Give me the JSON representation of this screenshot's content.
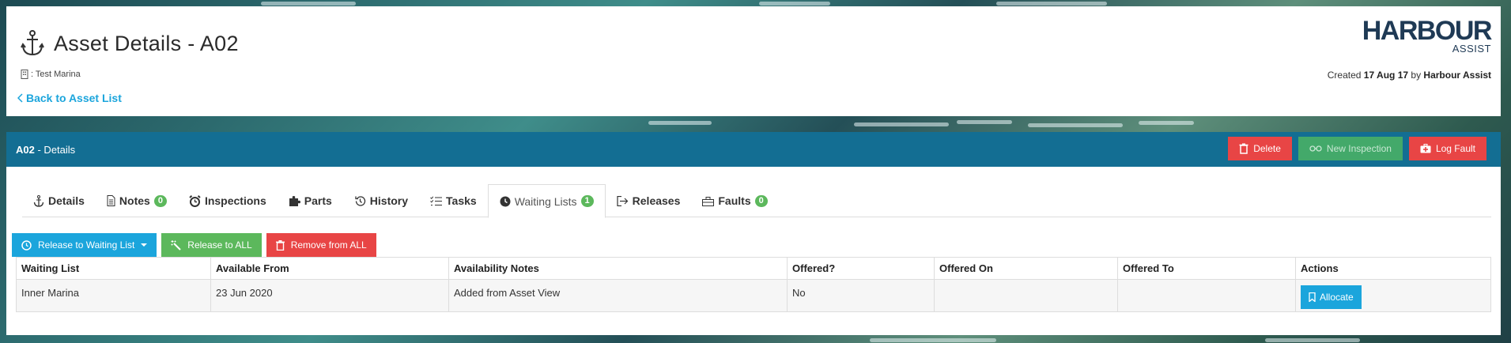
{
  "header": {
    "title": "Asset Details - A02",
    "marina": ": Test Marina",
    "back_link": "Back to Asset List",
    "logo_main": "HARBOUR",
    "logo_sub": "ASSIST",
    "created_prefix": "Created",
    "created_date": "17 Aug 17",
    "created_by_prefix": "by",
    "created_by": "Harbour Assist"
  },
  "details_bar": {
    "asset": "A02",
    "suffix": "- Details",
    "buttons": {
      "delete": "Delete",
      "new_inspection": "New Inspection",
      "log_fault": "Log Fault"
    }
  },
  "tabs": [
    {
      "label": "Details",
      "icon": "anchor-icon"
    },
    {
      "label": "Notes",
      "badge": "0",
      "icon": "file-icon"
    },
    {
      "label": "Inspections",
      "icon": "alarm-icon"
    },
    {
      "label": "Parts",
      "icon": "puzzle-icon"
    },
    {
      "label": "History",
      "icon": "history-icon"
    },
    {
      "label": "Tasks",
      "icon": "checklist-icon"
    },
    {
      "label": "Waiting Lists",
      "badge": "1",
      "icon": "clock-icon",
      "active": true
    },
    {
      "label": "Releases",
      "icon": "exit-icon"
    },
    {
      "label": "Faults",
      "badge": "0",
      "icon": "toolbox-icon"
    }
  ],
  "toolbar": {
    "release_waiting": "Release to Waiting List",
    "release_all": "Release to ALL",
    "remove_all": "Remove from ALL"
  },
  "table": {
    "columns": [
      "Waiting List",
      "Available From",
      "Availability Notes",
      "Offered?",
      "Offered On",
      "Offered To",
      "Actions"
    ],
    "rows": [
      {
        "waiting_list": "Inner Marina",
        "available_from": "23 Jun 2020",
        "notes": "Added from Asset View",
        "offered": "No",
        "offered_on": "",
        "offered_to": "",
        "action": "Allocate"
      }
    ]
  },
  "colors": {
    "bar_blue": "#136e93",
    "link_blue": "#1ba5dc",
    "danger": "#e84545",
    "success": "#5cb85c"
  }
}
